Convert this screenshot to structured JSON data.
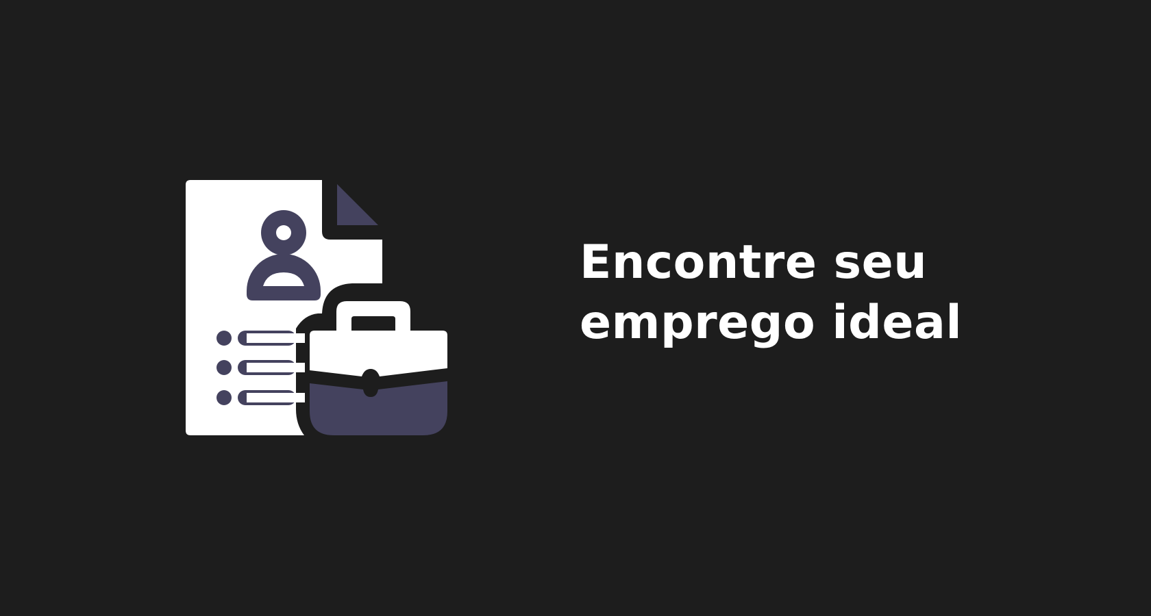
{
  "headline": {
    "line1": "Encontre seu",
    "line2": "emprego ideal"
  },
  "icons": {
    "illustration": "resume-document-icon",
    "person": "user-profile-icon",
    "list": "bullet-list-icon",
    "briefcase": "briefcase-icon"
  },
  "colors": {
    "background": "#1d1d1d",
    "foreground": "#ffffff",
    "accent": "#44425e"
  }
}
